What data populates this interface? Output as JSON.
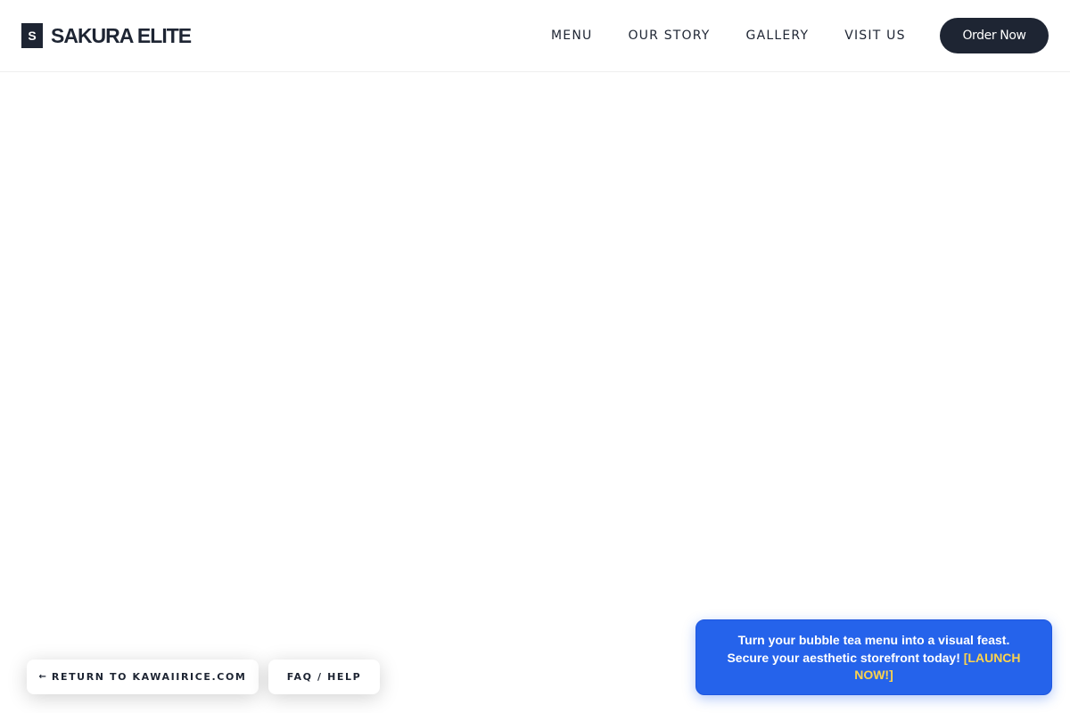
{
  "brand": {
    "mark": "S",
    "name": "SAKURA ELITE"
  },
  "nav": {
    "items": [
      {
        "label": "MENU"
      },
      {
        "label": "OUR STORY"
      },
      {
        "label": "GALLERY"
      },
      {
        "label": "VISIT US"
      }
    ],
    "order_label": "Order Now"
  },
  "footer_buttons": {
    "return_arrow": "←",
    "return_label": "RETURN TO KAWAIIRICE.COM",
    "faq_label": "FAQ / HELP"
  },
  "promo": {
    "line1": "Turn your bubble tea menu into a visual feast.",
    "line2": "Secure your aesthetic storefront today!",
    "cta": "[LAUNCH NOW!]"
  },
  "colors": {
    "primary_dark": "#1e2533",
    "promo_blue": "#2563eb",
    "cta_yellow": "#fcd34d"
  }
}
